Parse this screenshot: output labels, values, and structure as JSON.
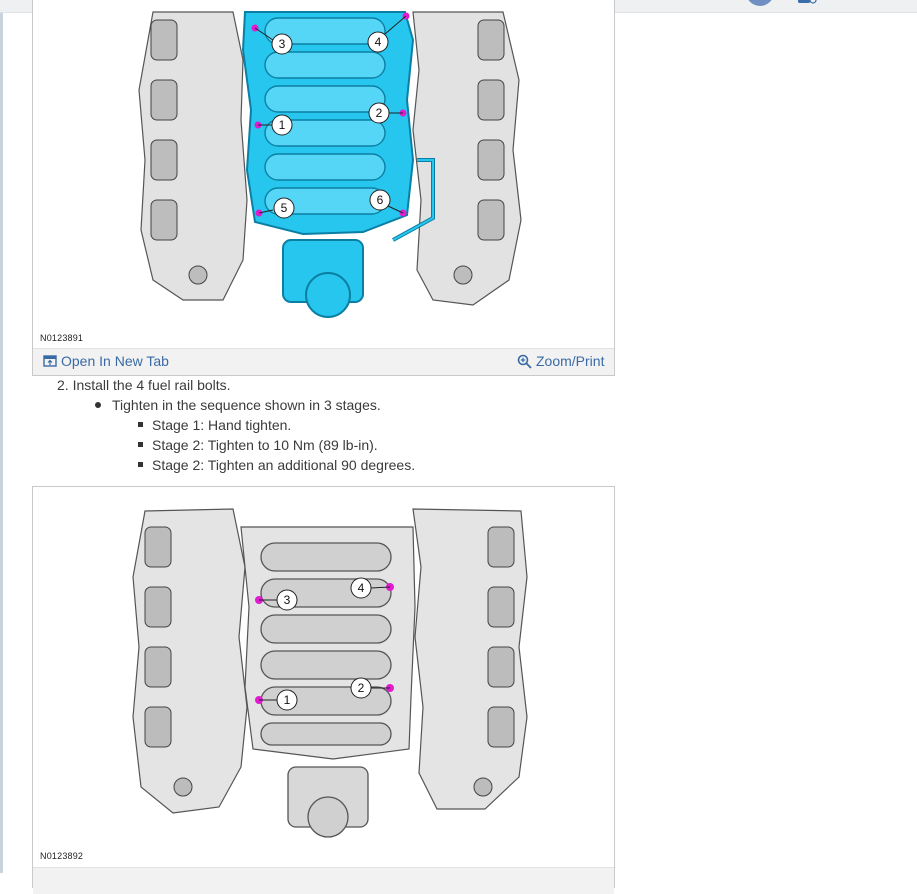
{
  "figures": [
    {
      "id_label": "N0123891",
      "open_label": "Open In New Tab",
      "zoom_label": "Zoom/Print",
      "callouts": [
        "1",
        "2",
        "3",
        "4",
        "5",
        "6"
      ]
    },
    {
      "id_label": "N0123892",
      "callouts": [
        "1",
        "2",
        "3",
        "4"
      ]
    }
  ],
  "step": {
    "text": "2. Install the 4 fuel rail bolts.",
    "bullet": "Tighten in the sequence shown in 3 stages.",
    "stages": [
      "Stage 1: Hand tighten.",
      "Stage 2: Tighten to 10 Nm (89 lb-in).",
      "Stage 2: Tighten an additional 90 degrees."
    ]
  },
  "colors": {
    "link": "#3a6aa5",
    "highlight_part": "#27c6ee",
    "bolt_marker": "#e01bd0"
  },
  "icons": [
    "open-in-new-tab-icon",
    "zoom-icon",
    "avatar",
    "chat-icon"
  ]
}
